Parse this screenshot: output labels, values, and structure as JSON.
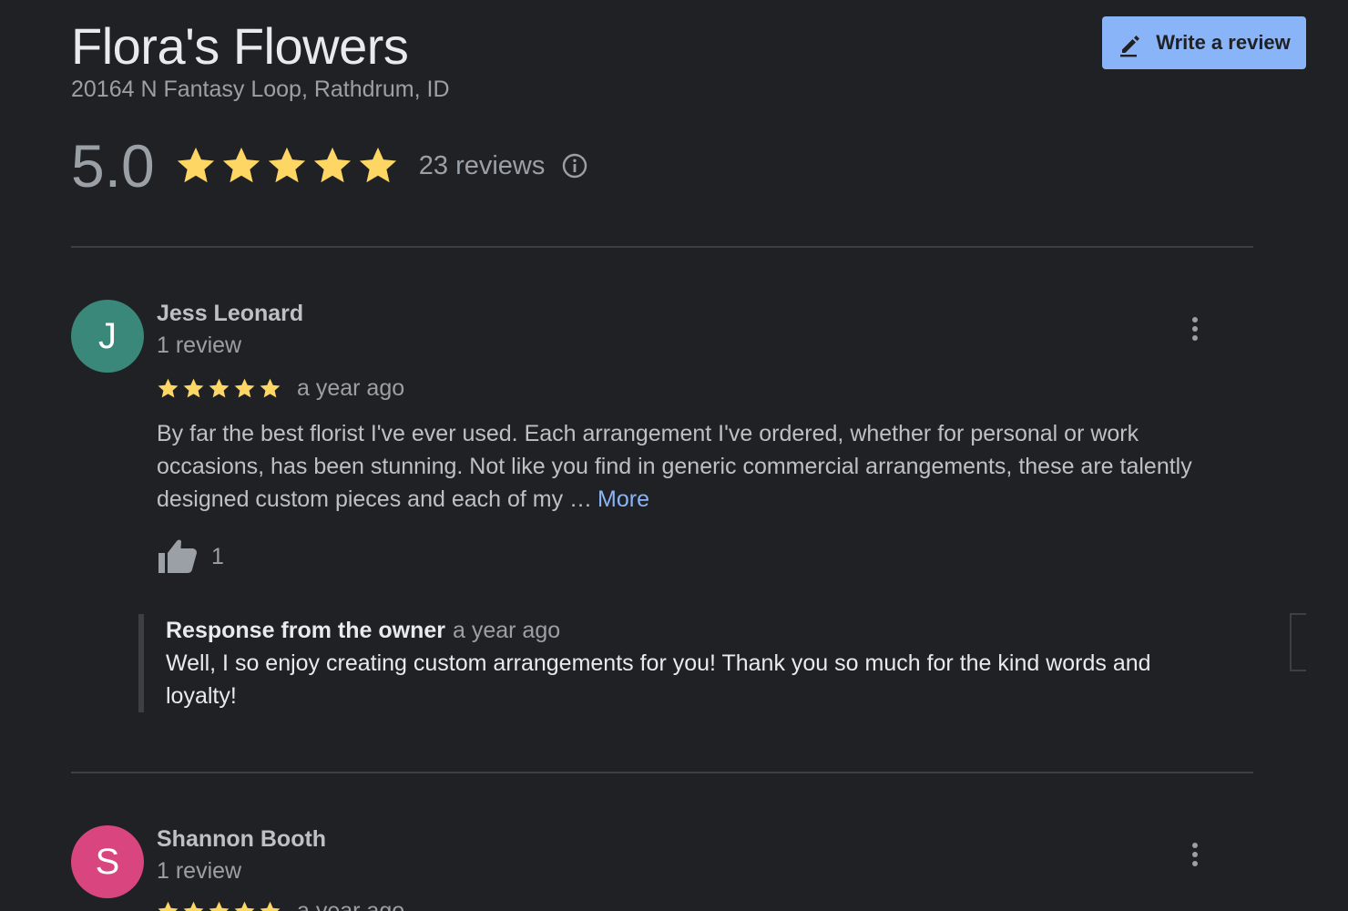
{
  "business": {
    "name": "Flora's Flowers",
    "address": "20164 N Fantasy Loop, Rathdrum, ID"
  },
  "write_review_label": "Write a review",
  "summary": {
    "rating": "5.0",
    "stars": 5,
    "reviews_label": "23 reviews"
  },
  "colors": {
    "background": "#202124",
    "star": "#fdd663",
    "link": "#8ab4f8",
    "button": "#8ab4f8",
    "avatar_j": "#39887a",
    "avatar_s": "#d9467f"
  },
  "icons": {
    "write": "pencil-icon",
    "info": "info-icon",
    "menu": "more-vert-icon",
    "like": "thumb-up-icon",
    "star": "star-icon"
  },
  "reviews": [
    {
      "initial": "J",
      "name": "Jess Leonard",
      "count": "1 review",
      "stars": 5,
      "date": "a year ago",
      "text": "By far the best florist I've ever used. Each arrangement I've ordered, whether for personal or work occasions, has been stunning. Not like you find in generic commercial arrangements, these are talently designed custom pieces and each of my …",
      "more_label": "More",
      "likes": "1",
      "response": {
        "title": "Response from the owner",
        "date": "a year ago",
        "text": "Well, I so enjoy creating custom arrangements for you! Thank you so much for the kind words and loyalty!"
      }
    },
    {
      "initial": "S",
      "name": "Shannon Booth",
      "count": "1 review",
      "stars": 5,
      "date": "a year ago"
    }
  ]
}
